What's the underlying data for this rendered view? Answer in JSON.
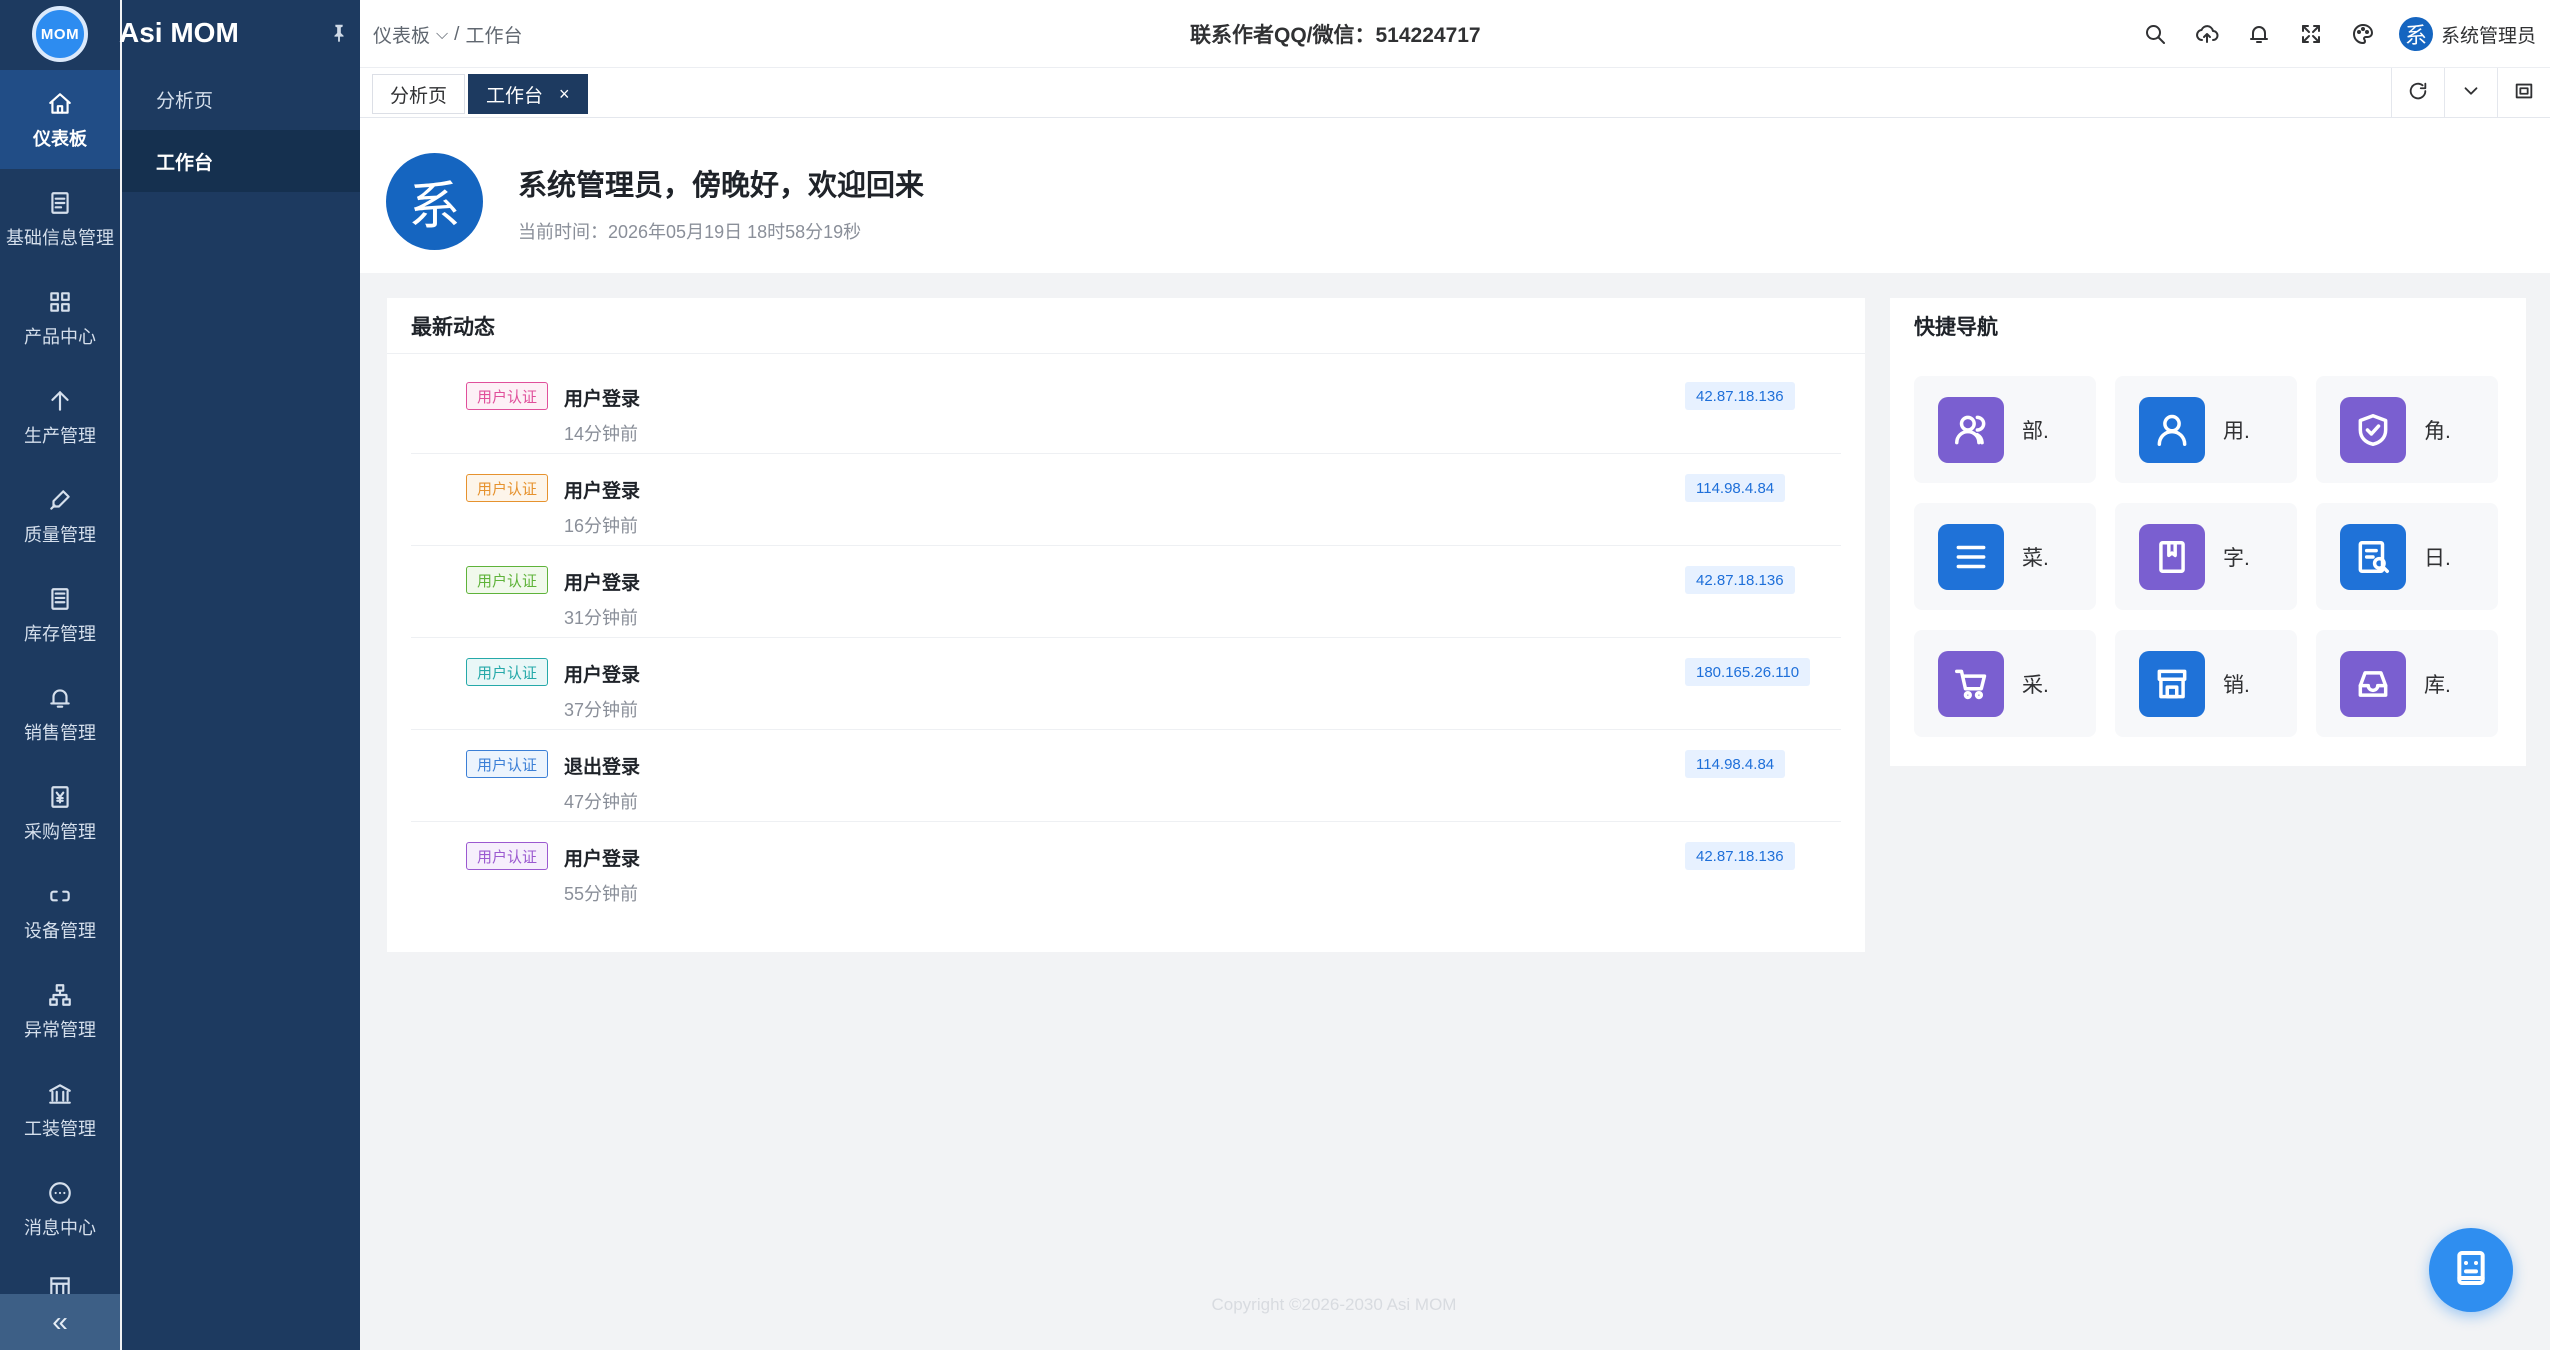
{
  "app": {
    "logo_text": "MOM",
    "title": "Asi MOM"
  },
  "rail": {
    "items": [
      {
        "label": "仪表板",
        "icon": "home-icon",
        "active": true
      },
      {
        "label": "基础信息管理",
        "icon": "document-icon"
      },
      {
        "label": "产品中心",
        "icon": "grid-icon"
      },
      {
        "label": "生产管理",
        "icon": "arrow-up-icon"
      },
      {
        "label": "质量管理",
        "icon": "pen-icon"
      },
      {
        "label": "库存管理",
        "icon": "list-doc-icon"
      },
      {
        "label": "销售管理",
        "icon": "bell-icon"
      },
      {
        "label": "采购管理",
        "icon": "yen-icon"
      },
      {
        "label": "设备管理",
        "icon": "link-icon"
      },
      {
        "label": "异常管理",
        "icon": "org-chart-icon"
      },
      {
        "label": "工装管理",
        "icon": "bank-icon"
      },
      {
        "label": "消息中心",
        "icon": "chat-icon"
      }
    ],
    "collapse_symbol": "«"
  },
  "submenu": {
    "items": [
      {
        "label": "分析页",
        "active": false
      },
      {
        "label": "工作台",
        "active": true
      }
    ]
  },
  "header": {
    "breadcrumb": {
      "first": "仪表板",
      "sep": "/",
      "current": "工作台"
    },
    "contact": "联系作者QQ/微信：514224717",
    "user": {
      "avatar_char": "系",
      "name": "系统管理员"
    },
    "icons": [
      "search-icon",
      "cloud-upload-icon",
      "bell-icon",
      "fullscreen-icon",
      "palette-icon"
    ]
  },
  "tabs": {
    "items": [
      {
        "label": "分析页",
        "active": false
      },
      {
        "label": "工作台",
        "active": true,
        "close": "×"
      }
    ]
  },
  "welcome": {
    "avatar_char": "系",
    "greeting": "系统管理员，傍晚好，欢迎回来",
    "time_label": "当前时间：",
    "time_value": "2026年05月19日 18时58分19秒"
  },
  "activity": {
    "title": "最新动态",
    "rows": [
      {
        "tag": "用户认证",
        "tag_color": "#e04f9b",
        "tag_bg": "#fdf0f6",
        "title": "用户登录",
        "time": "14分钟前",
        "ip": "42.87.18.136"
      },
      {
        "tag": "用户认证",
        "tag_color": "#e6922e",
        "tag_bg": "#fdf5ea",
        "title": "用户登录",
        "time": "16分钟前",
        "ip": "114.98.4.84"
      },
      {
        "tag": "用户认证",
        "tag_color": "#5fb33a",
        "tag_bg": "#f1f9ec",
        "title": "用户登录",
        "time": "31分钟前",
        "ip": "42.87.18.136"
      },
      {
        "tag": "用户认证",
        "tag_color": "#25a9a9",
        "tag_bg": "#e9f7f7",
        "title": "用户登录",
        "time": "37分钟前",
        "ip": "180.165.26.110"
      },
      {
        "tag": "用户认证",
        "tag_color": "#3b7fd6",
        "tag_bg": "#ecf4fd",
        "title": "退出登录",
        "time": "47分钟前",
        "ip": "114.98.4.84"
      },
      {
        "tag": "用户认证",
        "tag_color": "#9b59d0",
        "tag_bg": "#f6effc",
        "title": "用户登录",
        "time": "55分钟前",
        "ip": "42.87.18.136"
      }
    ]
  },
  "quicknav": {
    "title": "快捷导航",
    "items": [
      {
        "label": "部.",
        "icon": "users-icon",
        "color": "#7a5fd0"
      },
      {
        "label": "用.",
        "icon": "user-icon",
        "color": "#1f72d8"
      },
      {
        "label": "角.",
        "icon": "shield-check-icon",
        "color": "#7a5fd0"
      },
      {
        "label": "菜.",
        "icon": "menu-icon",
        "color": "#1f72d8"
      },
      {
        "label": "字.",
        "icon": "bookmark-icon",
        "color": "#7a5fd0"
      },
      {
        "label": "日.",
        "icon": "log-icon",
        "color": "#1f72d8"
      },
      {
        "label": "采.",
        "icon": "cart-icon",
        "color": "#7a5fd0"
      },
      {
        "label": "销.",
        "icon": "store-icon",
        "color": "#1f72d8"
      },
      {
        "label": "库.",
        "icon": "inbox-icon",
        "color": "#7a5fd0"
      }
    ]
  },
  "footer": {
    "text": "Copyright ©2026-2030 Asi MOM"
  }
}
